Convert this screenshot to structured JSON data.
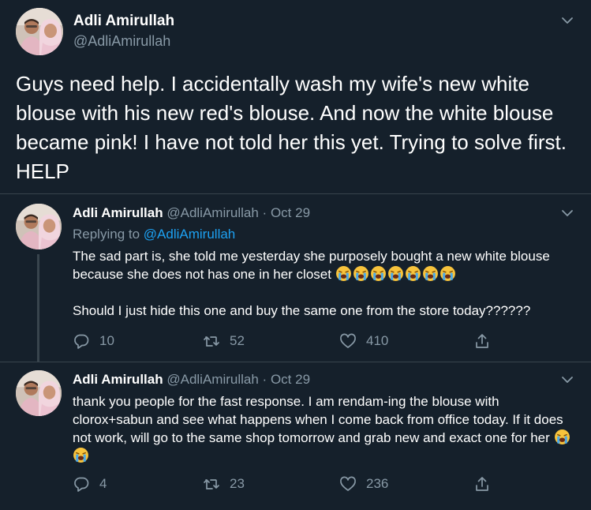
{
  "main_tweet": {
    "name": "Adli Amirullah",
    "handle": "@AdliAmirullah",
    "text": "Guys need help. I accidentally wash my wife's new white blouse with his new red's blouse. And now the white blouse became pink! I have not told her this yet. Trying to solve first. HELP"
  },
  "replies": [
    {
      "name": "Adli Amirullah",
      "handle": "@AdliAmirullah",
      "separator": "·",
      "date": "Oct 29",
      "replying_prefix": "Replying to",
      "replying_to": "@AdliAmirullah",
      "paragraph_1": "The sad part is, she told me yesterday she purposely bought a new white blouse because she does not has one in her closet",
      "paragraph_1_emoji": [
        "loudly-crying-face",
        "loudly-crying-face",
        "loudly-crying-face",
        "loudly-crying-face",
        "loudly-crying-face",
        "loudly-crying-face",
        "loudly-crying-face"
      ],
      "paragraph_2": "Should I just hide this one and buy the same one from the store today??????",
      "reply_count": "10",
      "retweet_count": "52",
      "like_count": "410"
    },
    {
      "name": "Adli Amirullah",
      "handle": "@AdliAmirullah",
      "separator": "·",
      "date": "Oct 29",
      "paragraph_1": "thank you people for the fast response. I am rendam-ing the blouse with clorox+sabun and see what happens when I come back from office today. If it does not work, will go to the same shop tomorrow and grab new and exact one for her",
      "paragraph_1_emoji": [
        "loudly-crying-face",
        "loudly-crying-face"
      ],
      "reply_count": "4",
      "retweet_count": "23",
      "like_count": "236"
    }
  ],
  "icons": {
    "more": "chevron-down-icon",
    "reply": "reply-bubble-icon",
    "retweet": "retweet-icon",
    "like": "heart-icon",
    "share": "share-icon"
  },
  "colors": {
    "background": "#15202b",
    "text": "#ffffff",
    "secondary": "#8899a6",
    "link": "#1da1f2",
    "border": "#38444d"
  }
}
